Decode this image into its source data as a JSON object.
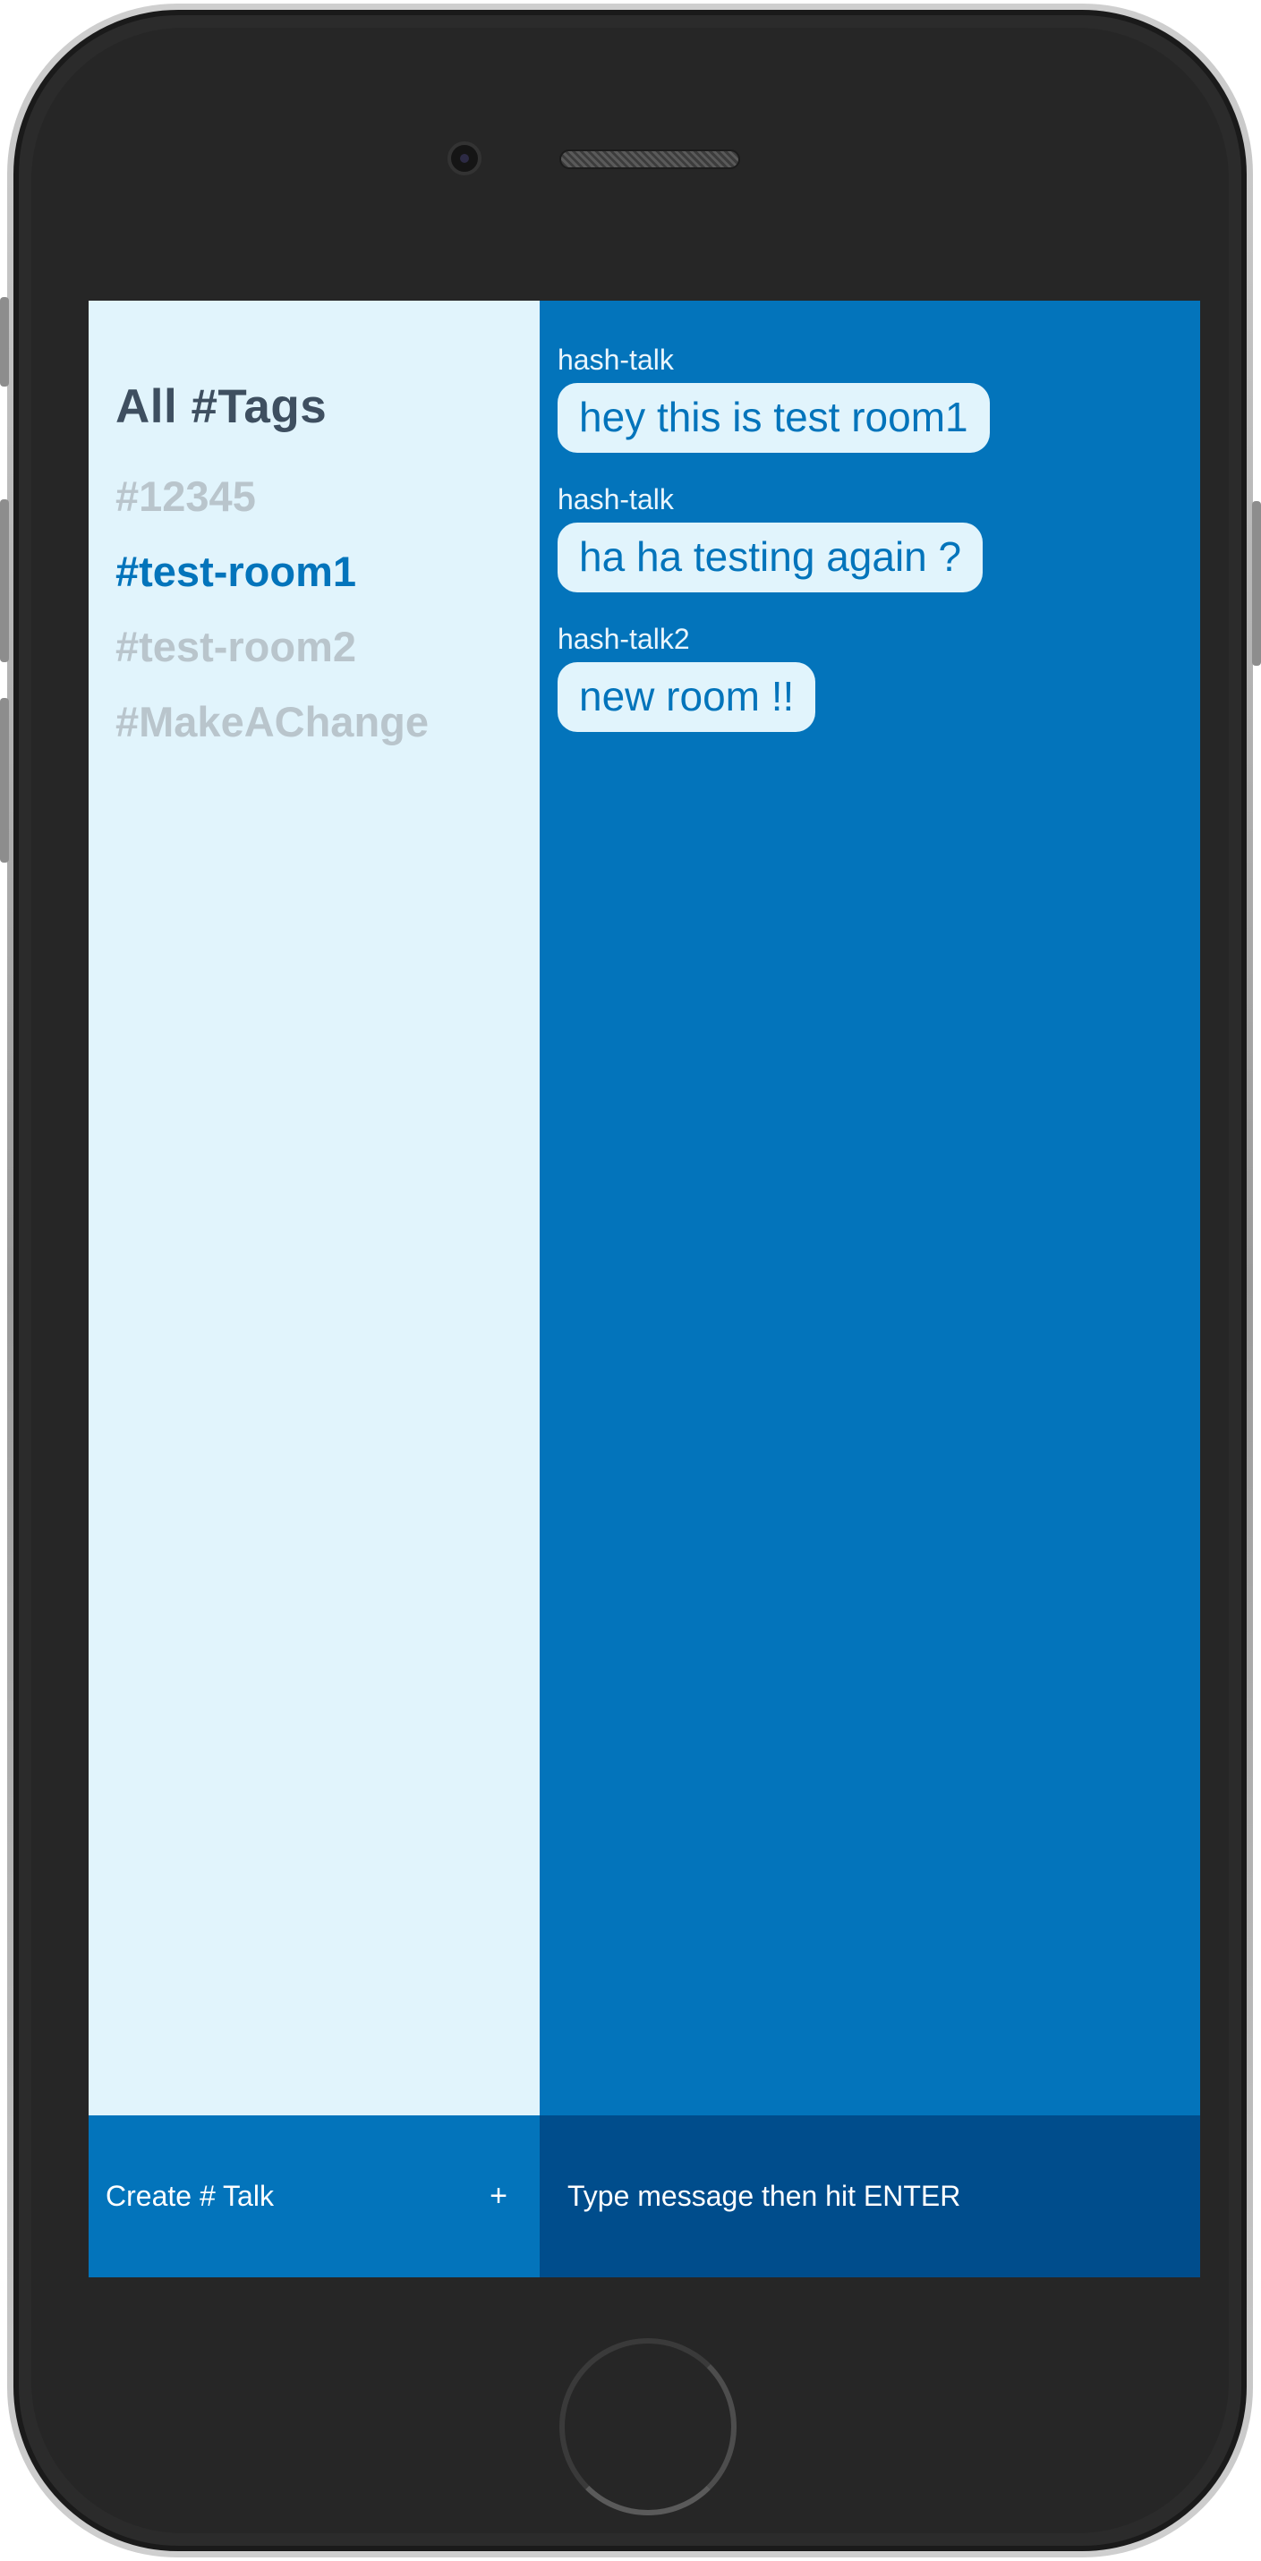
{
  "sidebar": {
    "title": "All #Tags",
    "tags": [
      {
        "label": "#12345",
        "active": false
      },
      {
        "label": "#test-room1",
        "active": true
      },
      {
        "label": "#test-room2",
        "active": false
      },
      {
        "label": "#MakeAChange",
        "active": false
      }
    ]
  },
  "chat": {
    "messages": [
      {
        "sender": "hash-talk",
        "text": "hey this is test room1"
      },
      {
        "sender": "hash-talk",
        "text": "ha ha testing again ?"
      },
      {
        "sender": "hash-talk2",
        "text": "new room !!"
      }
    ]
  },
  "footer": {
    "create_label": "Create # Talk",
    "create_icon": "+",
    "message_placeholder": "Type message then hit ENTER"
  },
  "colors": {
    "sidebar_bg": "#e1f4fc",
    "chat_bg": "#0374bb",
    "input_bg": "#004d8c",
    "active_tag": "#0374bb",
    "inactive_tag": "#b9c5cc",
    "title": "#3e4f60"
  },
  "icons": {
    "add": "plus-icon"
  }
}
